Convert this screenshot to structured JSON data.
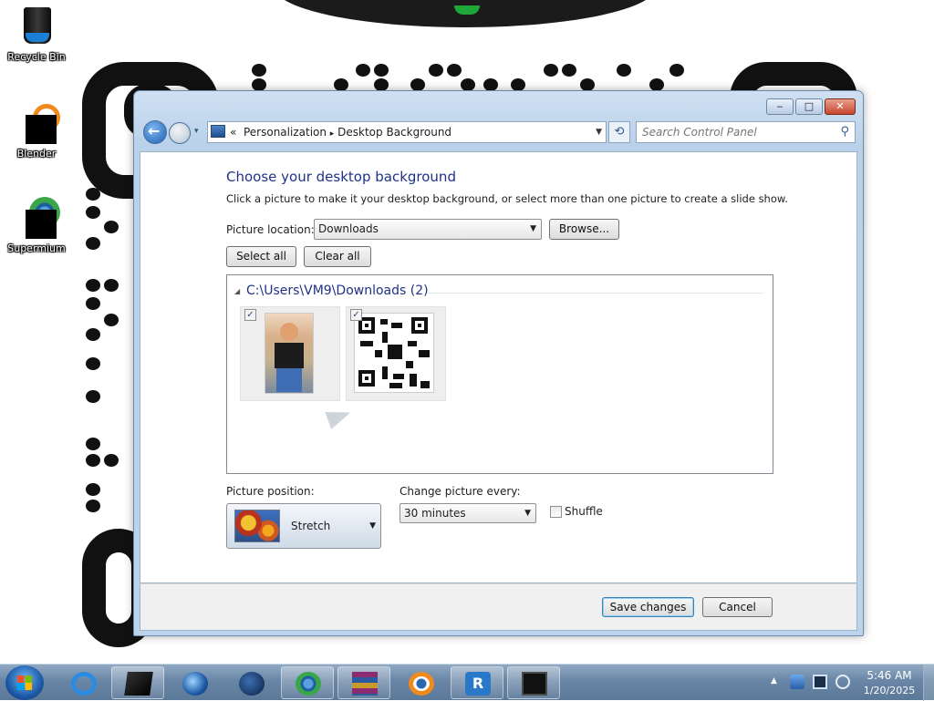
{
  "desktop": {
    "icons": [
      {
        "label": "Recycle Bin",
        "icon": "recycle-bin-icon"
      },
      {
        "label": "Blender",
        "icon": "blender-icon"
      },
      {
        "label": "Supermium",
        "icon": "supermium-icon"
      }
    ]
  },
  "window": {
    "caption_buttons": {
      "minimize": "‒",
      "maximize": "□",
      "close": "✕"
    },
    "navigation": {
      "back_icon": "back-arrow-icon",
      "forward_icon": "forward-arrow-icon",
      "history_glyph": "▾",
      "breadcrumb_prefix": "«",
      "breadcrumbs": [
        "Personalization",
        "Desktop Background"
      ],
      "separator": "▸",
      "refresh_glyph": "⟲",
      "search_placeholder": "Search Control Panel"
    },
    "content": {
      "title": "Choose your desktop background",
      "description": "Click a picture to make it your desktop background, or select more than one picture to create a slide show.",
      "picture_location_label": "Picture location:",
      "picture_location_value": "Downloads",
      "browse_label": "Browse...",
      "select_all_label": "Select all",
      "clear_all_label": "Clear all",
      "group_header": "C:\\Users\\VM9\\Downloads (2)",
      "pictures": [
        {
          "name": "photo-thumbnail",
          "checked": true
        },
        {
          "name": "qr-code-thumbnail",
          "checked": true
        }
      ],
      "picture_position_label": "Picture position:",
      "picture_position_value": "Stretch",
      "change_picture_label": "Change picture every:",
      "change_picture_value": "30 minutes",
      "shuffle_label": "Shuffle",
      "shuffle_checked": false
    },
    "footer": {
      "save_label": "Save changes",
      "cancel_label": "Cancel"
    }
  },
  "taskbar": {
    "start_icon": "windows-start-icon",
    "pinned": [
      "internet-explorer-icon",
      "black-box-app-icon",
      "media-player-icon",
      "globe-app-icon",
      "supermium-icon",
      "winrar-icon",
      "blender-icon",
      "rvc-app-icon",
      "terminal-window-icon"
    ],
    "tray_arrow": "▲",
    "clock_time": "5:46 AM",
    "clock_date": "1/20/2025"
  },
  "colors": {
    "accent_title": "#1e3287",
    "window_frame": "#b9d1ea",
    "taskbar": "#6a86a6",
    "close_button": "#c8452e"
  }
}
